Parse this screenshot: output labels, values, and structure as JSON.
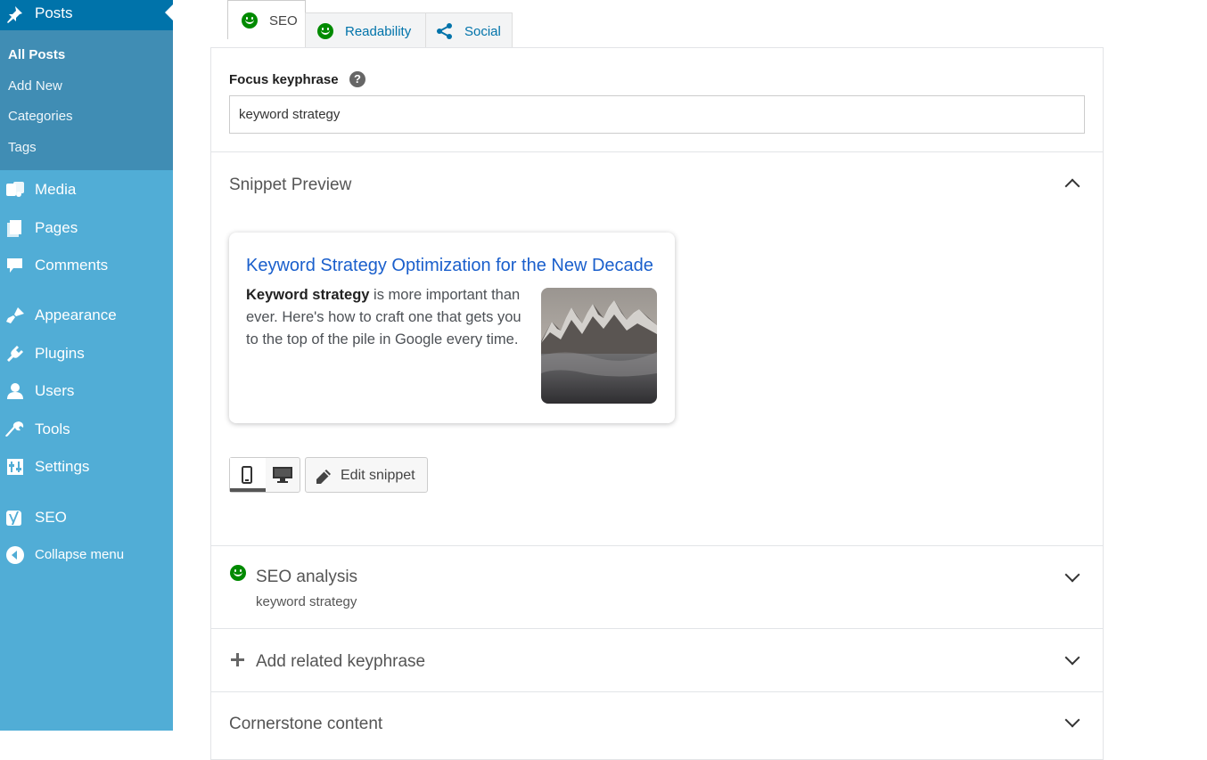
{
  "sidebar": {
    "posts_label": "Posts",
    "submenu": [
      "All Posts",
      "Add New",
      "Categories",
      "Tags"
    ],
    "items": [
      {
        "label": "Media",
        "icon": "media-icon"
      },
      {
        "label": "Pages",
        "icon": "pages-icon"
      },
      {
        "label": "Comments",
        "icon": "comments-icon"
      },
      {
        "label": "Appearance",
        "icon": "appearance-icon"
      },
      {
        "label": "Plugins",
        "icon": "plugins-icon"
      },
      {
        "label": "Users",
        "icon": "users-icon"
      },
      {
        "label": "Tools",
        "icon": "tools-icon"
      },
      {
        "label": "Settings",
        "icon": "settings-icon"
      },
      {
        "label": "SEO",
        "icon": "yoast-icon"
      },
      {
        "label": "Collapse menu",
        "icon": "collapse-icon"
      }
    ]
  },
  "tabs": [
    {
      "label": "SEO",
      "icon": "smiley-good-icon"
    },
    {
      "label": "Readability",
      "icon": "smiley-good-icon"
    },
    {
      "label": "Social",
      "icon": "share-icon"
    }
  ],
  "focus": {
    "label": "Focus keyphrase",
    "help": "?",
    "value": "keyword strategy"
  },
  "snippet": {
    "section_title": "Snippet Preview",
    "title": "Keyword Strategy Optimization for the New Decade",
    "desc_bold": "Keyword strategy",
    "desc_rest": " is more important than ever. Here's how to craft one that gets you to the top of the pile in Google every time.",
    "edit_label": "Edit snippet"
  },
  "analysis": {
    "title": "SEO analysis",
    "keyphrase": "keyword strategy"
  },
  "related": {
    "title": "Add related keyphrase"
  },
  "cornerstone": {
    "title": "Cornerstone content"
  },
  "colors": {
    "sidebar": "#51add6",
    "sidebar_active": "#0073aa",
    "good": "#008a00",
    "link": "#1a5fcc"
  }
}
